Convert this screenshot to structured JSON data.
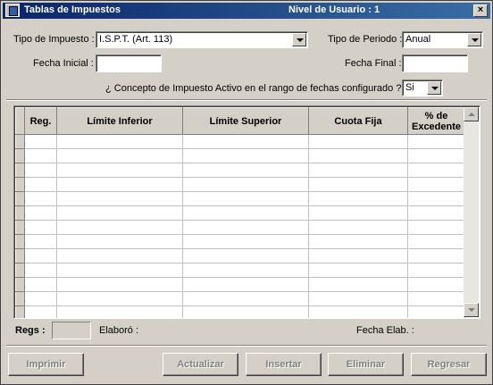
{
  "window": {
    "title": "Tablas de Impuestos",
    "user_level": "Nivel de Usuario : 1",
    "close_label": "×"
  },
  "filters": {
    "tipo_impuesto_label": "Tipo de Impuesto :",
    "tipo_impuesto_value": "I.S.P.T. (Art. 113)",
    "tipo_periodo_label": "Tipo de Periodo :",
    "tipo_periodo_value": "Anual",
    "fecha_inicial_label": "Fecha Inicial :",
    "fecha_inicial_value": "",
    "fecha_final_label": "Fecha Final :",
    "fecha_final_value": "",
    "concepto_label": "¿ Concepto de Impuesto Activo en el rango de fechas configurado ?  :",
    "concepto_value": "Si"
  },
  "table": {
    "columns": [
      "Reg.",
      "Límite Inferior",
      "Límite Superior",
      "Cuota Fija",
      "% de Excedente"
    ],
    "rows": [
      [],
      [],
      [],
      [],
      [],
      [],
      [],
      [],
      [],
      [],
      [],
      [],
      []
    ]
  },
  "footer": {
    "regs_label": "Regs :",
    "regs_value": "",
    "elaboro_label": "Elaboró :",
    "fecha_elab_label": "Fecha Elab. :"
  },
  "buttons": {
    "imprimir": "Imprimir",
    "actualizar": "Actualizar",
    "insertar": "Insertar",
    "eliminar": "Eliminar",
    "regresar": "Regresar"
  }
}
